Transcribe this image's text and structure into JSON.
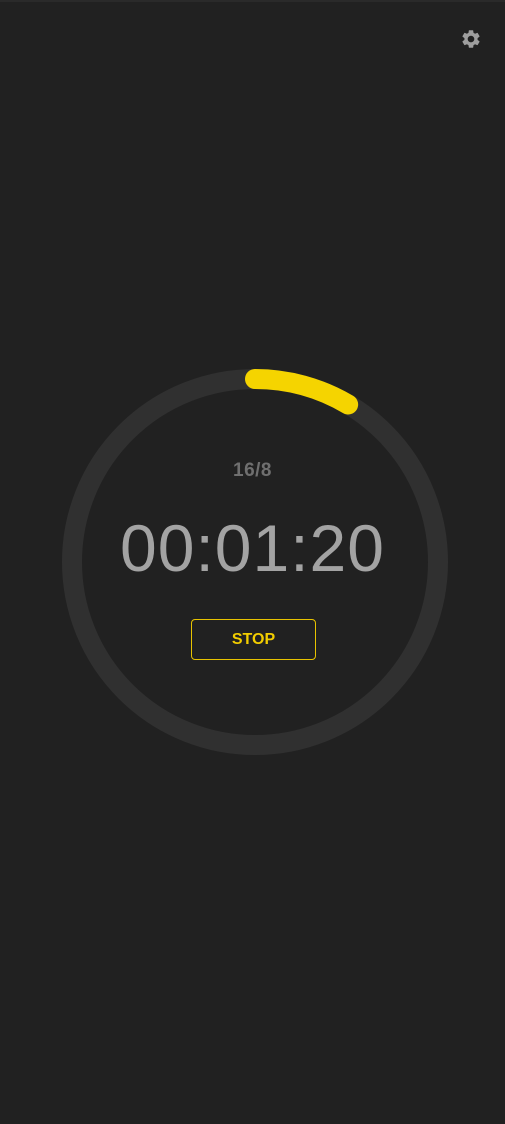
{
  "header": {
    "settings_icon": "gear-icon"
  },
  "timer": {
    "fasting_plan": "16/8",
    "elapsed_time": "00:01:20",
    "progress_fraction": 0.085,
    "stop_label": "STOP"
  },
  "colors": {
    "background": "#212121",
    "track": "#303030",
    "accent": "#f5d400",
    "text_muted": "#6f6f6f",
    "time_text": "#a3a3a3"
  }
}
